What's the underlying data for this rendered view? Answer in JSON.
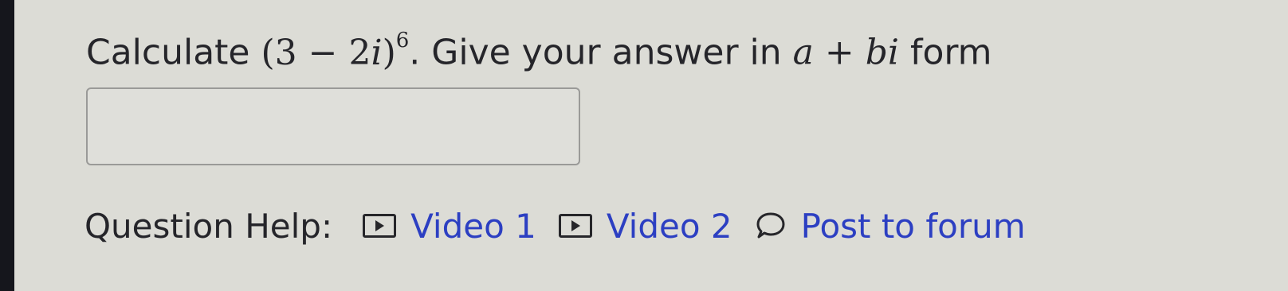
{
  "question": {
    "prefix": "Calculate",
    "expression_base": "(3 − 2",
    "expression_var": "i",
    "expression_close": ")",
    "exponent": "6",
    "middle_text": ". Give your answer in",
    "form_a": "a",
    "form_plus": " + ",
    "form_b": "bi",
    "suffix": "form"
  },
  "answer_input": {
    "value": "",
    "placeholder": ""
  },
  "help": {
    "label": "Question Help:",
    "links": [
      {
        "label": "Video 1",
        "icon": "video-icon"
      },
      {
        "label": "Video 2",
        "icon": "video-icon"
      },
      {
        "label": "Post to forum",
        "icon": "speech-bubble-icon"
      }
    ]
  },
  "colors": {
    "background": "#dcdcd6",
    "text": "#25252a",
    "link": "#2c3fc2",
    "input_border": "#9a9a98"
  }
}
